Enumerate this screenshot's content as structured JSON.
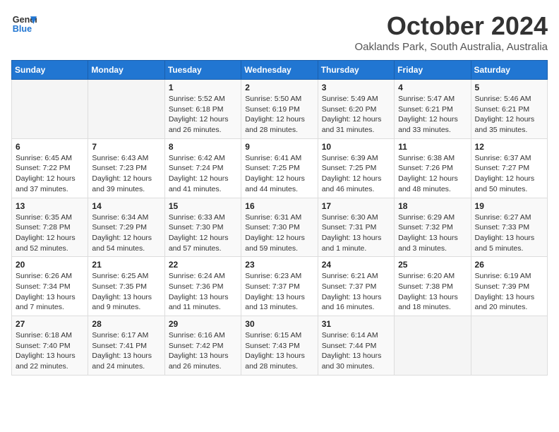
{
  "logo": {
    "line1": "General",
    "line2": "Blue"
  },
  "title": "October 2024",
  "subtitle": "Oaklands Park, South Australia, Australia",
  "days_of_week": [
    "Sunday",
    "Monday",
    "Tuesday",
    "Wednesday",
    "Thursday",
    "Friday",
    "Saturday"
  ],
  "weeks": [
    [
      {
        "day": "",
        "info": ""
      },
      {
        "day": "",
        "info": ""
      },
      {
        "day": "1",
        "info": "Sunrise: 5:52 AM\nSunset: 6:18 PM\nDaylight: 12 hours and 26 minutes."
      },
      {
        "day": "2",
        "info": "Sunrise: 5:50 AM\nSunset: 6:19 PM\nDaylight: 12 hours and 28 minutes."
      },
      {
        "day": "3",
        "info": "Sunrise: 5:49 AM\nSunset: 6:20 PM\nDaylight: 12 hours and 31 minutes."
      },
      {
        "day": "4",
        "info": "Sunrise: 5:47 AM\nSunset: 6:21 PM\nDaylight: 12 hours and 33 minutes."
      },
      {
        "day": "5",
        "info": "Sunrise: 5:46 AM\nSunset: 6:21 PM\nDaylight: 12 hours and 35 minutes."
      }
    ],
    [
      {
        "day": "6",
        "info": "Sunrise: 6:45 AM\nSunset: 7:22 PM\nDaylight: 12 hours and 37 minutes."
      },
      {
        "day": "7",
        "info": "Sunrise: 6:43 AM\nSunset: 7:23 PM\nDaylight: 12 hours and 39 minutes."
      },
      {
        "day": "8",
        "info": "Sunrise: 6:42 AM\nSunset: 7:24 PM\nDaylight: 12 hours and 41 minutes."
      },
      {
        "day": "9",
        "info": "Sunrise: 6:41 AM\nSunset: 7:25 PM\nDaylight: 12 hours and 44 minutes."
      },
      {
        "day": "10",
        "info": "Sunrise: 6:39 AM\nSunset: 7:25 PM\nDaylight: 12 hours and 46 minutes."
      },
      {
        "day": "11",
        "info": "Sunrise: 6:38 AM\nSunset: 7:26 PM\nDaylight: 12 hours and 48 minutes."
      },
      {
        "day": "12",
        "info": "Sunrise: 6:37 AM\nSunset: 7:27 PM\nDaylight: 12 hours and 50 minutes."
      }
    ],
    [
      {
        "day": "13",
        "info": "Sunrise: 6:35 AM\nSunset: 7:28 PM\nDaylight: 12 hours and 52 minutes."
      },
      {
        "day": "14",
        "info": "Sunrise: 6:34 AM\nSunset: 7:29 PM\nDaylight: 12 hours and 54 minutes."
      },
      {
        "day": "15",
        "info": "Sunrise: 6:33 AM\nSunset: 7:30 PM\nDaylight: 12 hours and 57 minutes."
      },
      {
        "day": "16",
        "info": "Sunrise: 6:31 AM\nSunset: 7:30 PM\nDaylight: 12 hours and 59 minutes."
      },
      {
        "day": "17",
        "info": "Sunrise: 6:30 AM\nSunset: 7:31 PM\nDaylight: 13 hours and 1 minute."
      },
      {
        "day": "18",
        "info": "Sunrise: 6:29 AM\nSunset: 7:32 PM\nDaylight: 13 hours and 3 minutes."
      },
      {
        "day": "19",
        "info": "Sunrise: 6:27 AM\nSunset: 7:33 PM\nDaylight: 13 hours and 5 minutes."
      }
    ],
    [
      {
        "day": "20",
        "info": "Sunrise: 6:26 AM\nSunset: 7:34 PM\nDaylight: 13 hours and 7 minutes."
      },
      {
        "day": "21",
        "info": "Sunrise: 6:25 AM\nSunset: 7:35 PM\nDaylight: 13 hours and 9 minutes."
      },
      {
        "day": "22",
        "info": "Sunrise: 6:24 AM\nSunset: 7:36 PM\nDaylight: 13 hours and 11 minutes."
      },
      {
        "day": "23",
        "info": "Sunrise: 6:23 AM\nSunset: 7:37 PM\nDaylight: 13 hours and 13 minutes."
      },
      {
        "day": "24",
        "info": "Sunrise: 6:21 AM\nSunset: 7:37 PM\nDaylight: 13 hours and 16 minutes."
      },
      {
        "day": "25",
        "info": "Sunrise: 6:20 AM\nSunset: 7:38 PM\nDaylight: 13 hours and 18 minutes."
      },
      {
        "day": "26",
        "info": "Sunrise: 6:19 AM\nSunset: 7:39 PM\nDaylight: 13 hours and 20 minutes."
      }
    ],
    [
      {
        "day": "27",
        "info": "Sunrise: 6:18 AM\nSunset: 7:40 PM\nDaylight: 13 hours and 22 minutes."
      },
      {
        "day": "28",
        "info": "Sunrise: 6:17 AM\nSunset: 7:41 PM\nDaylight: 13 hours and 24 minutes."
      },
      {
        "day": "29",
        "info": "Sunrise: 6:16 AM\nSunset: 7:42 PM\nDaylight: 13 hours and 26 minutes."
      },
      {
        "day": "30",
        "info": "Sunrise: 6:15 AM\nSunset: 7:43 PM\nDaylight: 13 hours and 28 minutes."
      },
      {
        "day": "31",
        "info": "Sunrise: 6:14 AM\nSunset: 7:44 PM\nDaylight: 13 hours and 30 minutes."
      },
      {
        "day": "",
        "info": ""
      },
      {
        "day": "",
        "info": ""
      }
    ]
  ]
}
